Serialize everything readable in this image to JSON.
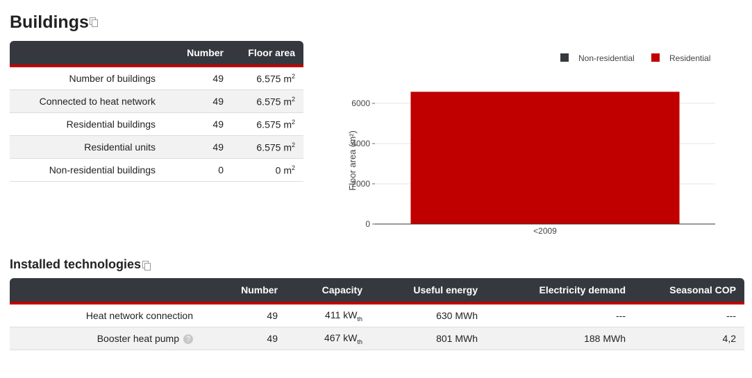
{
  "buildings": {
    "title": "Buildings",
    "headers": [
      "",
      "Number",
      "Floor area"
    ],
    "rows": [
      {
        "label": "Number of buildings",
        "number": "49",
        "area": "6.575 m",
        "unit_sup": "2"
      },
      {
        "label": "Connected to heat network",
        "number": "49",
        "area": "6.575 m",
        "unit_sup": "2"
      },
      {
        "label": "Residential buildings",
        "number": "49",
        "area": "6.575 m",
        "unit_sup": "2"
      },
      {
        "label": "Residential units",
        "number": "49",
        "area": "6.575 m",
        "unit_sup": "2"
      },
      {
        "label": "Non-residential buildings",
        "number": "0",
        "area": "0 m",
        "unit_sup": "2"
      }
    ]
  },
  "chart_data": {
    "type": "bar",
    "categories": [
      "<2009"
    ],
    "series": [
      {
        "name": "Non-residential",
        "values": [
          0
        ],
        "color": "#35393f"
      },
      {
        "name": "Residential",
        "values": [
          6575
        ],
        "color": "#c00000"
      }
    ],
    "ylabel": "Floor area (m²)",
    "xlabel": "",
    "ylim": [
      0,
      7000
    ],
    "yticks": [
      0,
      2000,
      4000,
      6000
    ],
    "legend": "top-right",
    "grid": true
  },
  "technologies": {
    "title": "Installed technologies",
    "headers": [
      "",
      "Number",
      "Capacity",
      "Useful energy",
      "Electricity demand",
      "Seasonal COP"
    ],
    "rows": [
      {
        "label": "Heat network connection",
        "number": "49",
        "capacity": "411 kW",
        "capacity_sub": "th",
        "energy": "630 MWh",
        "electricity": "---",
        "cop": "---",
        "help": false
      },
      {
        "label": "Booster heat pump",
        "number": "49",
        "capacity": "467 kW",
        "capacity_sub": "th",
        "energy": "801 MWh",
        "electricity": "188 MWh",
        "cop": "4,2",
        "help": true,
        "help_icon": "question-icon",
        "help_glyph": "?"
      }
    ]
  }
}
